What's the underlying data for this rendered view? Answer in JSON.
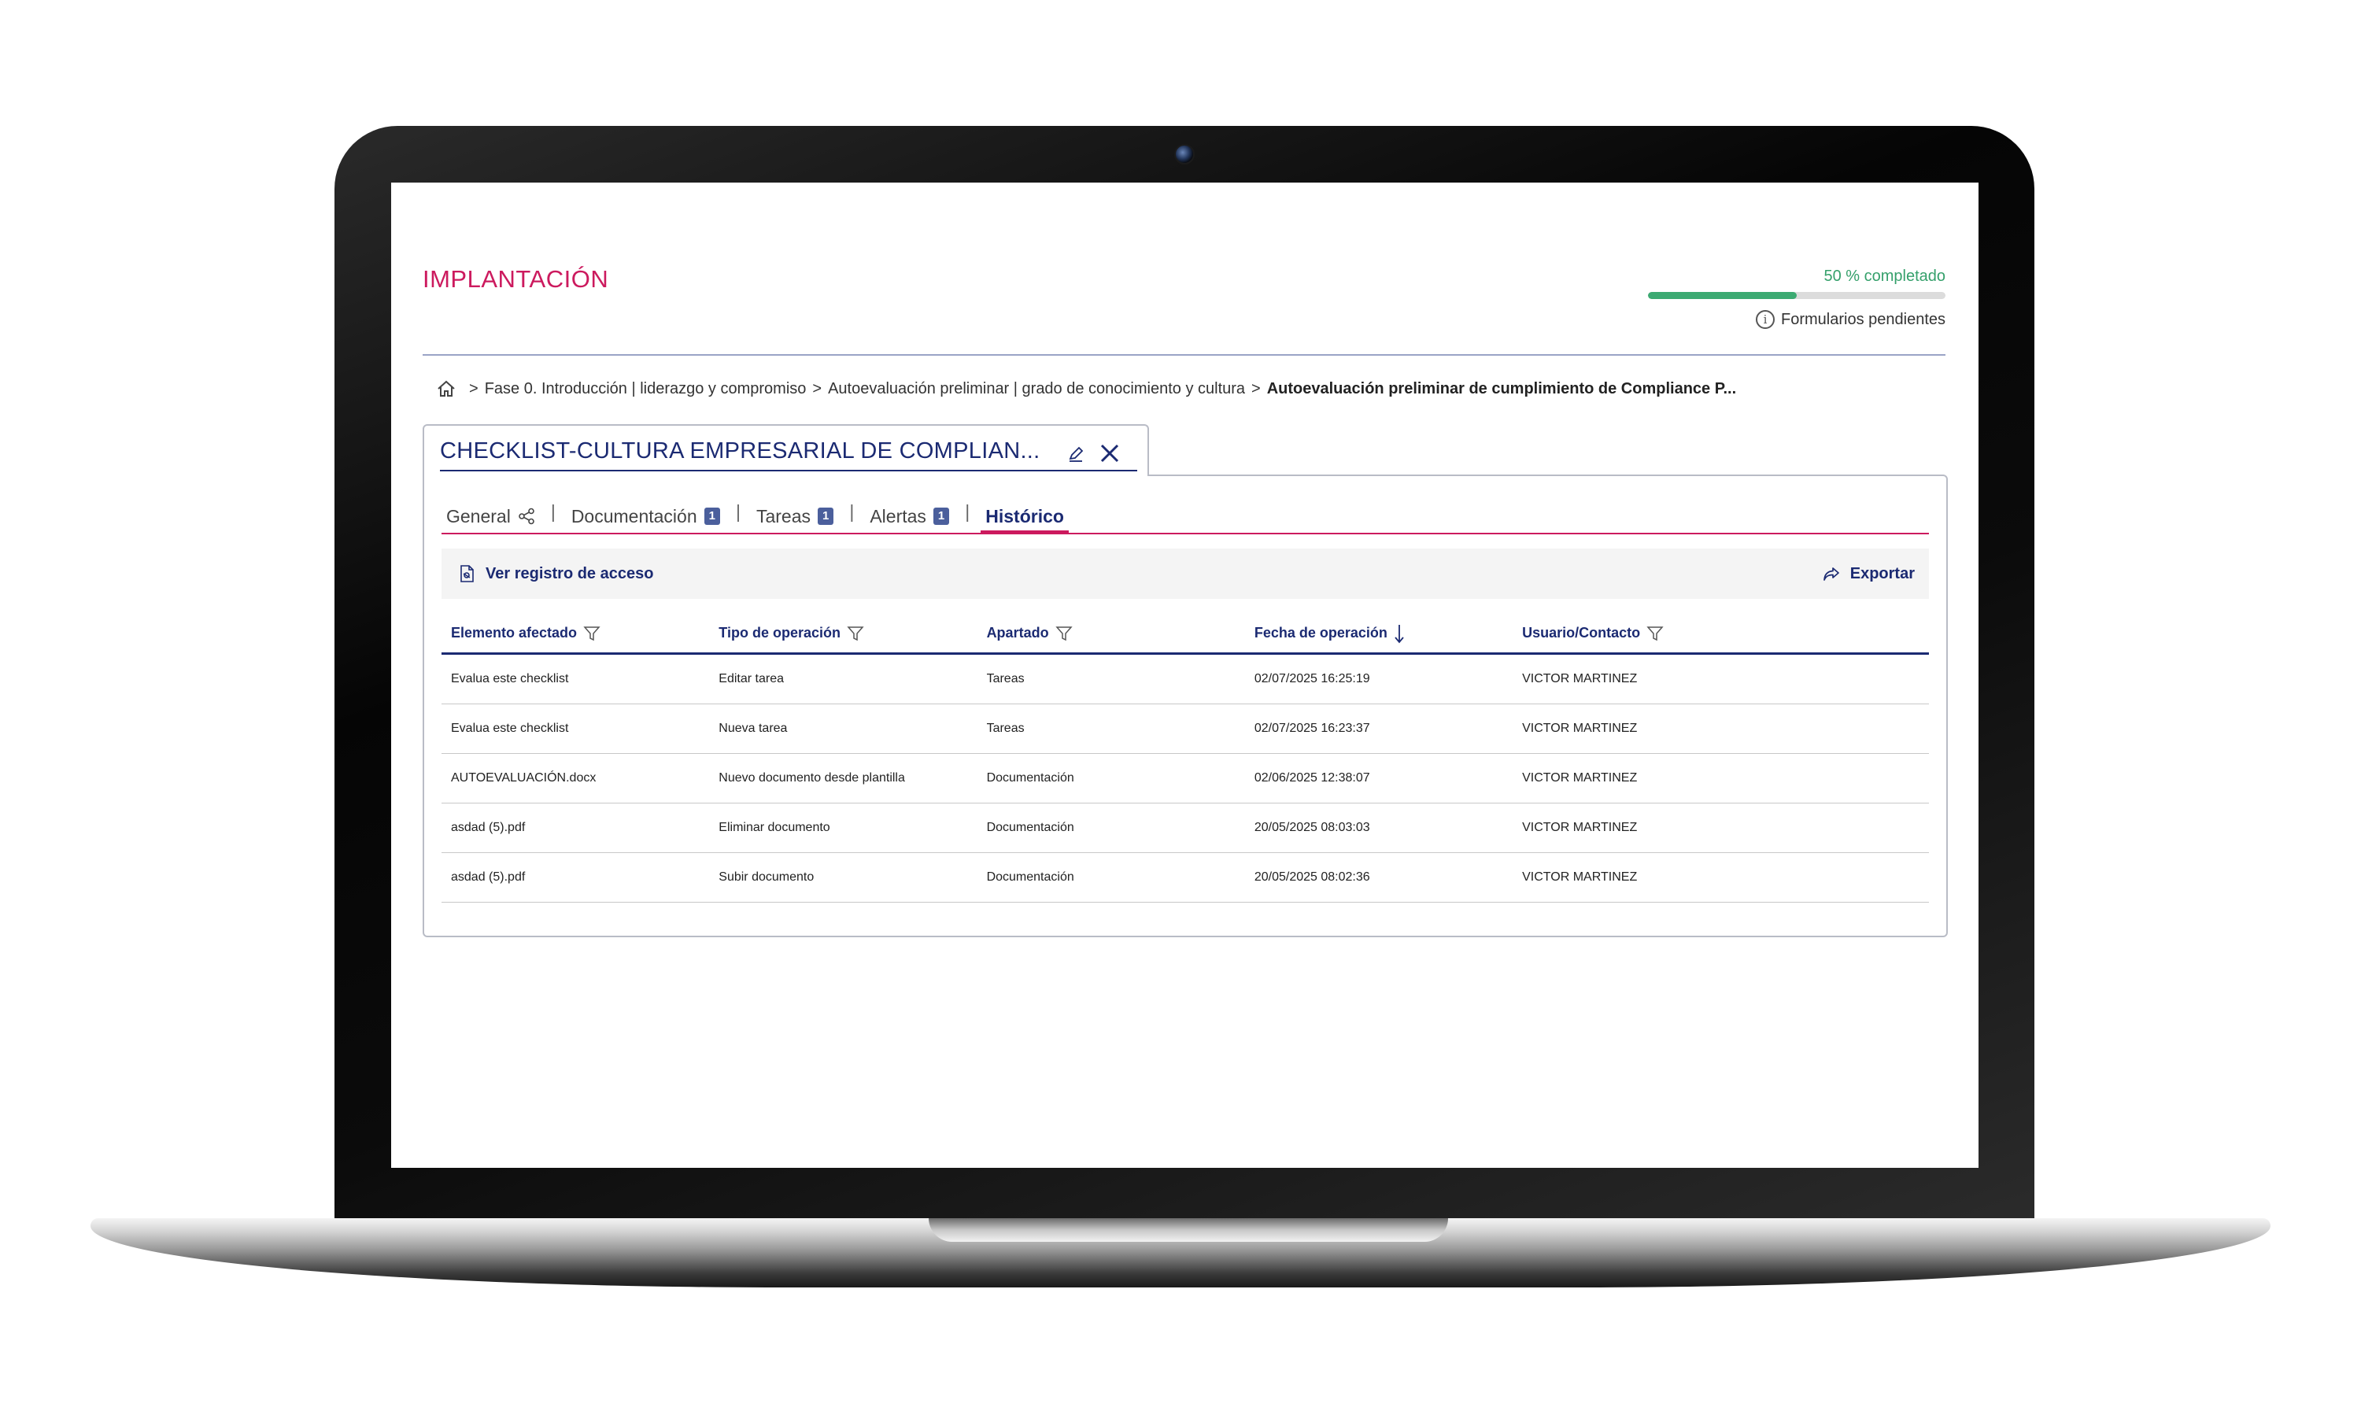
{
  "page": {
    "title": "IMPLANTACIÓN",
    "progress_label": "50 % completado",
    "progress_fraction": 0.5,
    "pending_forms": "Formularios pendientes"
  },
  "breadcrumb": {
    "icon": "home-icon",
    "items": [
      "Fase 0. Introducción  |  liderazgo y compromiso",
      "Autoevaluación preliminar  |  grado de conocimiento y cultura",
      "Autoevaluación preliminar de cumplimiento de Compliance P..."
    ],
    "separator": ">"
  },
  "panel": {
    "title": "CHECKLIST-CULTURA EMPRESARIAL DE COMPLIAN...",
    "tabs": [
      {
        "label": "General",
        "icon": "share-icon"
      },
      {
        "label": "Documentación",
        "badge": "1"
      },
      {
        "label": "Tareas",
        "badge": "1"
      },
      {
        "label": "Alertas",
        "badge": "1"
      },
      {
        "label": "Histórico",
        "active": true
      }
    ],
    "tab_separator": "|"
  },
  "toolbar": {
    "access_log_label": "Ver registro de acceso",
    "export_label": "Exportar"
  },
  "table": {
    "columns": [
      "Elemento afectado",
      "Tipo de operación",
      "Apartado",
      "Fecha de operación",
      "Usuario/Contacto"
    ],
    "rows": [
      [
        "Evalua este checklist",
        "Editar tarea",
        "Tareas",
        "02/07/2025 16:25:19",
        "VICTOR MARTINEZ"
      ],
      [
        "Evalua este checklist",
        "Nueva tarea",
        "Tareas",
        "02/07/2025 16:23:37",
        "VICTOR MARTINEZ"
      ],
      [
        "AUTOEVALUACIÓN.docx",
        "Nuevo documento desde plantilla",
        "Documentación",
        "02/06/2025 12:38:07",
        "VICTOR MARTINEZ"
      ],
      [
        "asdad (5).pdf",
        "Eliminar documento",
        "Documentación",
        "20/05/2025 08:03:03",
        "VICTOR MARTINEZ"
      ],
      [
        "asdad (5).pdf",
        "Subir documento",
        "Documentación",
        "20/05/2025 08:02:36",
        "VICTOR MARTINEZ"
      ]
    ]
  },
  "colors": {
    "accent": "#cc1a5e",
    "navy": "#1b2a72",
    "progress": "#3caa72",
    "badge": "#4b5f9c"
  }
}
